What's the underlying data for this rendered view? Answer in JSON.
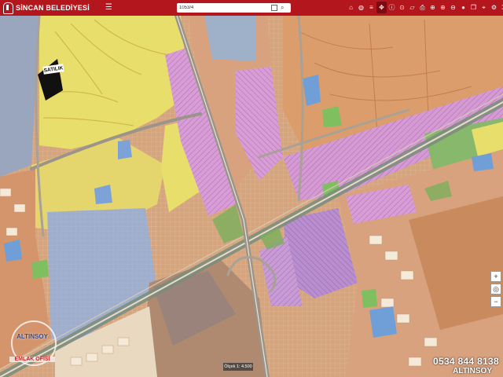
{
  "header": {
    "logo_text": "SİNCAN BELEDİYESİ",
    "menu_icon": "menu-icon"
  },
  "search": {
    "value": "1053/4",
    "button_icon": "search-icon"
  },
  "toolbar": {
    "icons": [
      "home-icon",
      "globe-icon",
      "layers-icon",
      "navigate-icon",
      "info-icon",
      "ruler-icon",
      "area-icon",
      "print-icon",
      "share-icon",
      "zoom-in-icon",
      "zoom-out-icon",
      "red-marker-icon",
      "bookmark-icon",
      "location-icon",
      "settings-icon",
      "fullscreen-icon"
    ]
  },
  "map": {
    "label_satilik": "SATILIK",
    "scale_text": "Ölçek 1: 4.500"
  },
  "zoom": {
    "in": "+",
    "out": "−",
    "locate": "◎"
  },
  "watermark": {
    "brand": "ALTINSOY",
    "sub": "EMLAK OFİSİ",
    "phone": "0534 844 8138",
    "brand2": "ALTINSOY"
  },
  "colors": {
    "header": "#b3161c",
    "residential": "#d9a073",
    "yellow_parcel": "#e9df70",
    "pink_parcel": "#d69bd6",
    "gray_parcel": "#a4b0c7",
    "green_parcel": "#82b56b",
    "road": "#8a857c"
  }
}
